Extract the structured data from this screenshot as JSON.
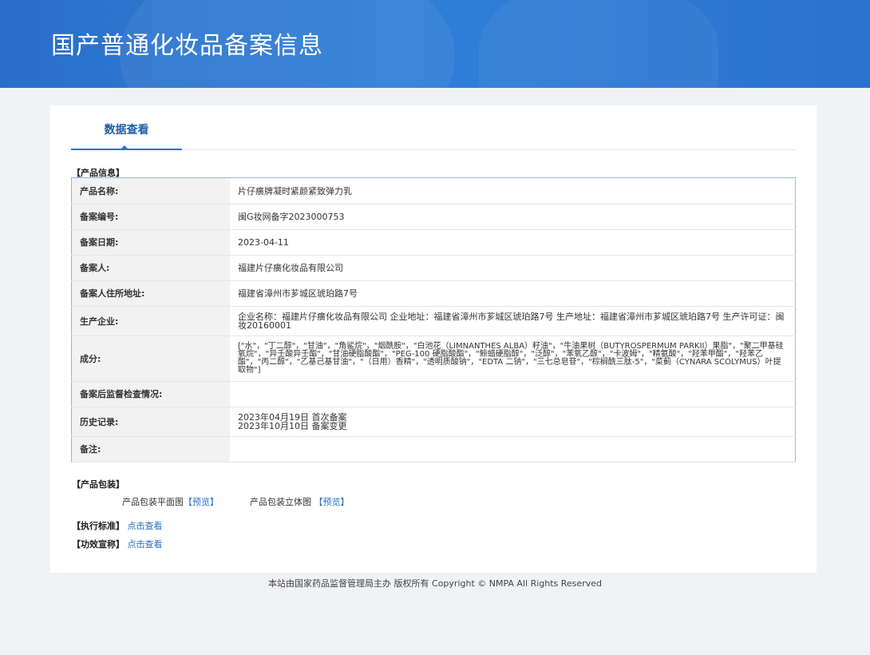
{
  "header": {
    "title": "国产普通化妆品备案信息"
  },
  "tabs": [
    {
      "label": "数据查看"
    }
  ],
  "product_info": {
    "section_title": "【产品信息】",
    "rows": [
      {
        "label": "产品名称:",
        "value": "片仔癀牌凝时紧颜紧致弹力乳"
      },
      {
        "label": "备案编号:",
        "value": "闽G妆网备字2023000753"
      },
      {
        "label": "备案日期:",
        "value": "2023-04-11"
      },
      {
        "label": "备案人:",
        "value": "福建片仔癀化妆品有限公司"
      },
      {
        "label": "备案人住所地址:",
        "value": "福建省漳州市芗城区琥珀路7号"
      },
      {
        "label": "生产企业:",
        "value": "企业名称：福建片仔癀化妆品有限公司 企业地址：福建省漳州市芗城区琥珀路7号 生产地址：福建省漳州市芗城区琥珀路7号 生产许可证：闽妆20160001"
      },
      {
        "label": "成分:",
        "value": "[\"水\"，\"丁二醇\"，\"甘油\"，\"角鲨烷\"，\"烟酰胺\"，\"白池花（LIMNANTHES ALBA）籽油\"，\"牛油果树（BUTYROSPERMUM PARKII）果脂\"，\"聚二甲基硅氧烷\"，\"异壬酸异壬酯\"，\"甘油硬脂酸酯\"，\"PEG-100 硬脂酸酯\"，\"鲸蜡硬脂醇\"，\"泛醇\"，\"苯氧乙醇\"，\"卡波姆\"，\"精氨酸\"，\"羟苯甲酯\"，\"羟苯乙酯\"，\"丙二醇\"，\"乙基己基甘油\"，\"（日用）香精\"，\"透明质酸钠\"，\"EDTA 二钠\"，\"三七总皂苷\"，\"棕榈酰三肽-5\"，\"菜蓟（CYNARA SCOLYMUS）叶提取物\"]"
      },
      {
        "label": "备案后监督检查情况:",
        "value": ""
      },
      {
        "label": "历史记录:",
        "value": "2023年04月19日 首次备案\n2023年10月10日 备案变更"
      },
      {
        "label": "备注:",
        "value": ""
      }
    ]
  },
  "packaging": {
    "section_title": "【产品包装】",
    "items": [
      {
        "label": "产品包装平面图",
        "link": "【预览】"
      },
      {
        "label": "产品包装立体图",
        "link": "【预览】"
      }
    ]
  },
  "standard": {
    "label": "【执行标准】",
    "link": "点击查看"
  },
  "efficacy": {
    "label": "【功效宣称】",
    "link": "点击查看"
  },
  "footer": {
    "text": "本站由国家药品监督管理局主办 版权所有 Copyright © NMPA All Rights Reserved"
  },
  "colors": {
    "banner": "#2f7fd8",
    "accent": "#2a73c9",
    "link": "#2a6fc0",
    "table_border": "#9ab6da"
  }
}
